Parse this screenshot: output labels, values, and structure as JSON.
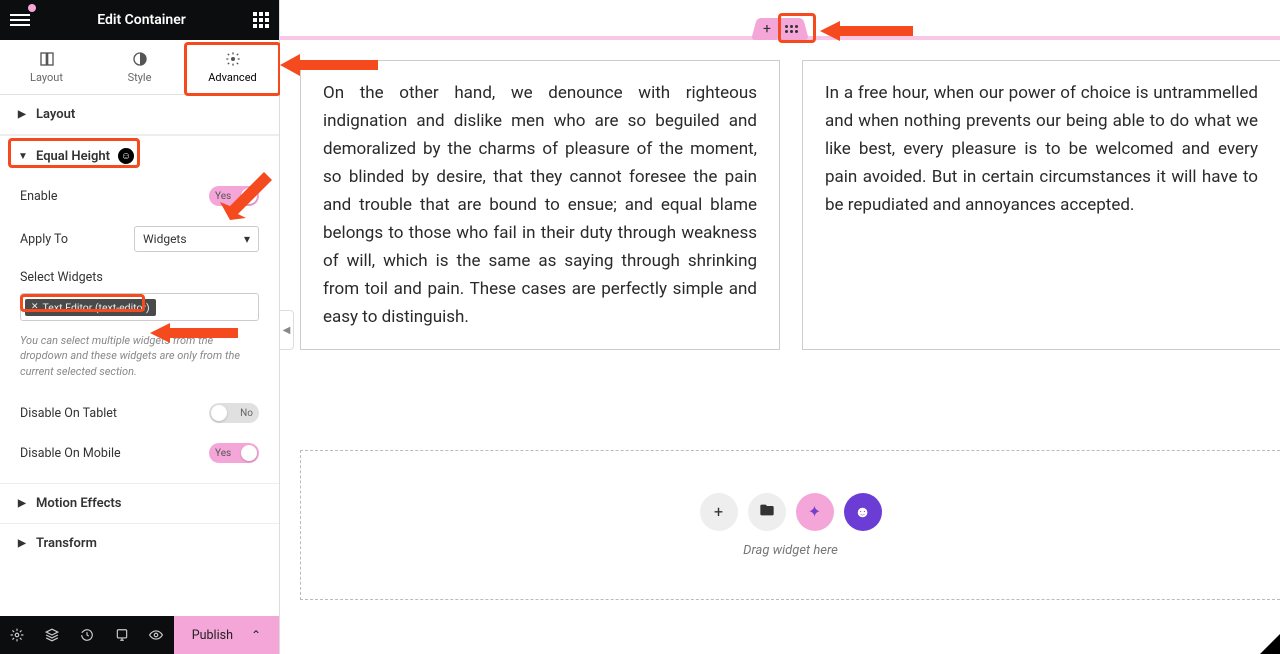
{
  "header": {
    "title": "Edit Container"
  },
  "tabs": {
    "layout": "Layout",
    "style": "Style",
    "advanced": "Advanced"
  },
  "sections": {
    "layout": "Layout",
    "equal_height": "Equal Height",
    "motion_effects": "Motion Effects",
    "transform": "Transform"
  },
  "controls": {
    "enable_label": "Enable",
    "enable_value": "Yes",
    "apply_to_label": "Apply To",
    "apply_to_value": "Widgets",
    "select_widgets": "Select Widgets",
    "widget_tag": "Text Editor (text-editor)",
    "helper": "You can select multiple widgets from the dropdown and these widgets are only from the current selected section.",
    "disable_tablet_label": "Disable On Tablet",
    "disable_tablet_value": "No",
    "disable_mobile_label": "Disable On Mobile",
    "disable_mobile_value": "Yes"
  },
  "footer": {
    "publish": "Publish"
  },
  "content": {
    "col1": "On the other hand, we denounce with righteous indignation and dislike men who are so beguiled and demoralized by the charms of pleasure of the moment, so blinded by desire, that they cannot foresee the pain and trouble that are bound to ensue; and equal blame belongs to those who fail in their duty through weakness of will, which is the same as saying through shrinking from toil and pain. These cases are perfectly simple and easy to distinguish.",
    "col2": "In a free hour, when our power of choice is untrammelled and when nothing prevents our being able to do what we like best, every pleasure is to be welcomed and every pain avoided. But in certain circumstances it will have to be repudiated and annoyances accepted."
  },
  "dropzone": {
    "label": "Drag widget here"
  }
}
